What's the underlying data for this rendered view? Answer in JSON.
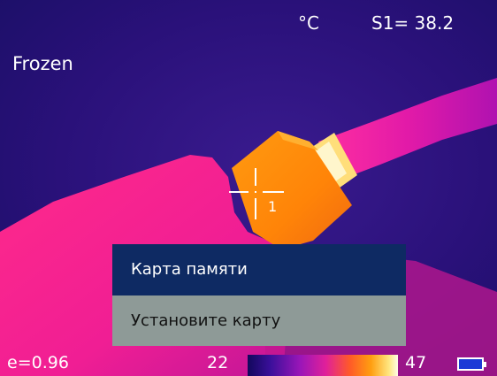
{
  "hud": {
    "unit": "°C",
    "spot_reading": "S1= 38.2",
    "mode": "Frozen",
    "emissivity": "e=0.96",
    "scale_min": "22",
    "scale_max": "47"
  },
  "crosshair": {
    "label": "1"
  },
  "dialog": {
    "title": "Карта памяти",
    "message": "Установите карту"
  },
  "icons": {
    "battery": "battery-icon"
  },
  "colors": {
    "dialog_title_bg": "#0e2a63",
    "dialog_msg_bg": "#8e9a97",
    "background": "#2a117a"
  }
}
